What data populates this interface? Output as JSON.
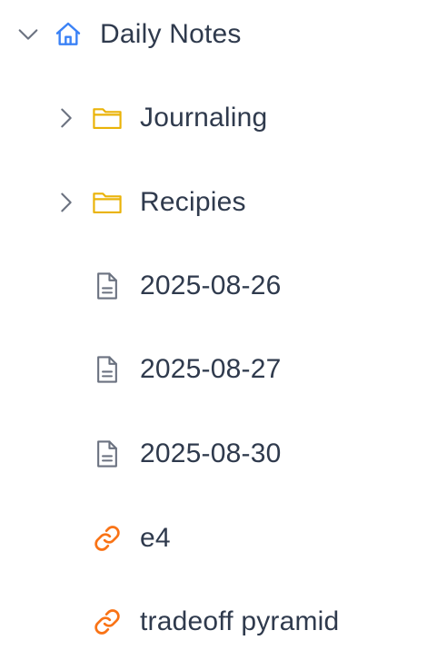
{
  "tree": {
    "root": {
      "label": "Daily Notes",
      "icon": "home-icon",
      "expanded": true,
      "icon_color": "#3b82f6"
    },
    "items": [
      {
        "type": "folder",
        "label": "Journaling",
        "icon": "folder-icon",
        "expanded": false,
        "icon_color": "#eab308"
      },
      {
        "type": "folder",
        "label": "Recipies",
        "icon": "folder-icon",
        "expanded": false,
        "icon_color": "#eab308"
      },
      {
        "type": "file",
        "label": "2025-08-26",
        "icon": "file-icon",
        "icon_color": "#6b7280"
      },
      {
        "type": "file",
        "label": "2025-08-27",
        "icon": "file-icon",
        "icon_color": "#6b7280"
      },
      {
        "type": "file",
        "label": "2025-08-30",
        "icon": "file-icon",
        "icon_color": "#6b7280"
      },
      {
        "type": "link",
        "label": "e4",
        "icon": "link-icon",
        "icon_color": "#f97316"
      },
      {
        "type": "link",
        "label": "tradeoff pyramid",
        "icon": "link-icon",
        "icon_color": "#f97316"
      }
    ]
  }
}
